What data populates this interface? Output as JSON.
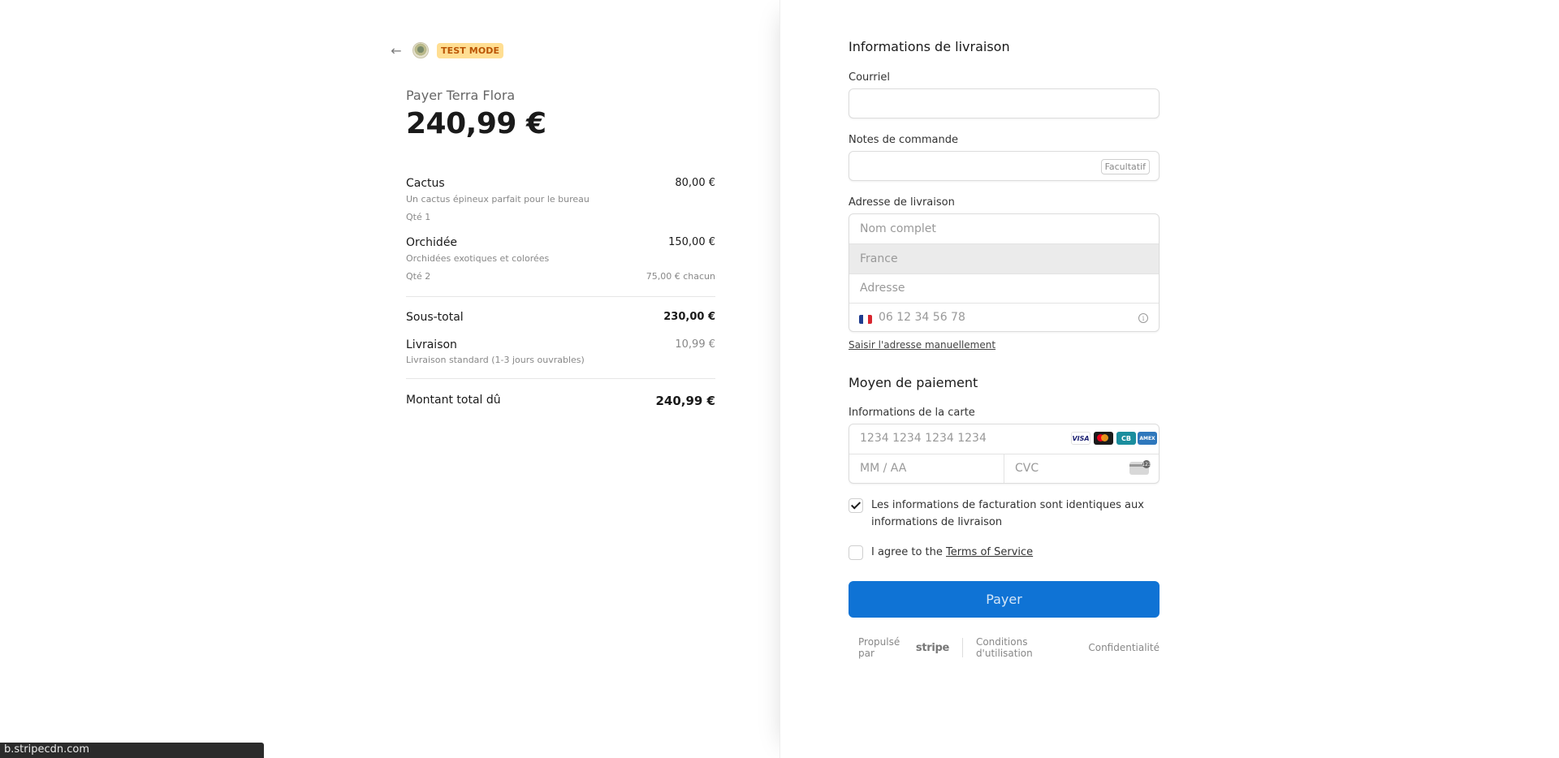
{
  "header": {
    "test_mode_badge": "TEST MODE"
  },
  "summary": {
    "pay_to": "Payer Terra Flora",
    "amount": "240,99 €",
    "items": [
      {
        "name": "Cactus",
        "description": "Un cactus épineux parfait pour le bureau",
        "qty": "Qté 1",
        "price": "80,00 €",
        "unit_price": ""
      },
      {
        "name": "Orchidée",
        "description": "Orchidées exotiques et colorées",
        "qty": "Qté 2",
        "price": "150,00 €",
        "unit_price": "75,00 € chacun"
      }
    ],
    "subtotal_label": "Sous-total",
    "subtotal_value": "230,00 €",
    "shipping_label": "Livraison",
    "shipping_desc": "Livraison standard (1-3 jours ouvrables)",
    "shipping_value": "10,99 €",
    "total_label": "Montant total dû",
    "total_value": "240,99 €"
  },
  "shipping_form": {
    "title": "Informations de livraison",
    "email_label": "Courriel",
    "notes_label": "Notes de commande",
    "optional_tag": "Facultatif",
    "address_label": "Adresse de livraison",
    "name_placeholder": "Nom complet",
    "country_value": "France",
    "address_placeholder": "Adresse",
    "phone_placeholder": "06 12 34 56 78",
    "manual_link": "Saisir l'adresse manuellement"
  },
  "payment": {
    "title": "Moyen de paiement",
    "card_label": "Informations de la carte",
    "card_number_placeholder": "1234 1234 1234 1234",
    "expiry_placeholder": "MM / AA",
    "cvc_placeholder": "CVC",
    "brands": {
      "visa": "VISA",
      "cb": "CB",
      "amex": "AMEX"
    },
    "billing_same_text": "Les informations de facturation sont identiques aux informations de livraison",
    "billing_same_checked": true,
    "terms_prefix": "I agree to the ",
    "terms_link": "Terms of Service",
    "terms_checked": false,
    "pay_button": "Payer"
  },
  "footer": {
    "powered_by": "Propulsé par",
    "stripe": "stripe",
    "terms": "Conditions d'utilisation",
    "privacy": "Confidentialité"
  },
  "status_bar": {
    "text": "b.stripecdn.com"
  },
  "colors": {
    "pay_button": "#0f73d5",
    "test_mode_bg": "#ffde92",
    "test_mode_text": "#bb5504"
  }
}
